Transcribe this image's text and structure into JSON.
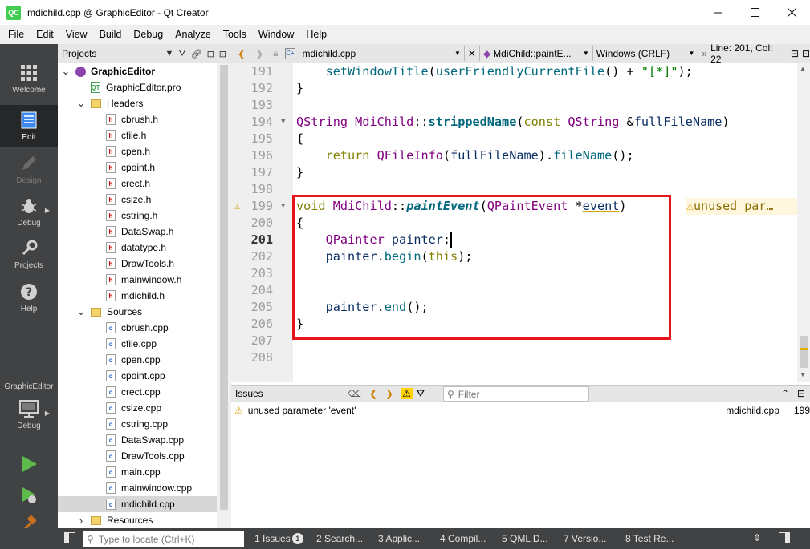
{
  "window": {
    "title": "mdichild.cpp @ GraphicEditor - Qt Creator",
    "app_icon": "QC",
    "controls": [
      "minimize-icon",
      "maximize-icon",
      "close-icon"
    ]
  },
  "menu": [
    "File",
    "Edit",
    "View",
    "Build",
    "Debug",
    "Analyze",
    "Tools",
    "Window",
    "Help"
  ],
  "modes": [
    {
      "label": "Welcome",
      "icon": "grid-icon",
      "state": "normal"
    },
    {
      "label": "Edit",
      "icon": "document-icon",
      "state": "active"
    },
    {
      "label": "Design",
      "icon": "pencil-icon",
      "state": "disabled"
    },
    {
      "label": "Debug",
      "icon": "bug-icon",
      "state": "normal"
    },
    {
      "label": "Projects",
      "icon": "wrench-icon",
      "state": "normal"
    },
    {
      "label": "Help",
      "icon": "help-icon",
      "state": "normal"
    }
  ],
  "kit": {
    "name": "GraphicEditor",
    "mode": "Debug"
  },
  "projects_pane": {
    "title": "Projects",
    "tree": [
      {
        "label": "GraphicEditor",
        "kind": "project",
        "depth": 0,
        "expanded": true,
        "bold": true
      },
      {
        "label": "GraphicEditor.pro",
        "kind": "pro",
        "depth": 1
      },
      {
        "label": "Headers",
        "kind": "folder",
        "depth": 1,
        "expanded": true
      },
      {
        "label": "cbrush.h",
        "kind": "h",
        "depth": 2
      },
      {
        "label": "cfile.h",
        "kind": "h",
        "depth": 2
      },
      {
        "label": "cpen.h",
        "kind": "h",
        "depth": 2
      },
      {
        "label": "cpoint.h",
        "kind": "h",
        "depth": 2
      },
      {
        "label": "crect.h",
        "kind": "h",
        "depth": 2
      },
      {
        "label": "csize.h",
        "kind": "h",
        "depth": 2
      },
      {
        "label": "cstring.h",
        "kind": "h",
        "depth": 2
      },
      {
        "label": "DataSwap.h",
        "kind": "h",
        "depth": 2
      },
      {
        "label": "datatype.h",
        "kind": "h",
        "depth": 2
      },
      {
        "label": "DrawTools.h",
        "kind": "h",
        "depth": 2
      },
      {
        "label": "mainwindow.h",
        "kind": "h",
        "depth": 2
      },
      {
        "label": "mdichild.h",
        "kind": "h",
        "depth": 2
      },
      {
        "label": "Sources",
        "kind": "folder",
        "depth": 1,
        "expanded": true
      },
      {
        "label": "cbrush.cpp",
        "kind": "cpp",
        "depth": 2
      },
      {
        "label": "cfile.cpp",
        "kind": "cpp",
        "depth": 2
      },
      {
        "label": "cpen.cpp",
        "kind": "cpp",
        "depth": 2
      },
      {
        "label": "cpoint.cpp",
        "kind": "cpp",
        "depth": 2
      },
      {
        "label": "crect.cpp",
        "kind": "cpp",
        "depth": 2
      },
      {
        "label": "csize.cpp",
        "kind": "cpp",
        "depth": 2
      },
      {
        "label": "cstring.cpp",
        "kind": "cpp",
        "depth": 2
      },
      {
        "label": "DataSwap.cpp",
        "kind": "cpp",
        "depth": 2
      },
      {
        "label": "DrawTools.cpp",
        "kind": "cpp",
        "depth": 2
      },
      {
        "label": "main.cpp",
        "kind": "cpp",
        "depth": 2
      },
      {
        "label": "mainwindow.cpp",
        "kind": "cpp",
        "depth": 2
      },
      {
        "label": "mdichild.cpp",
        "kind": "cpp",
        "depth": 2,
        "selected": true
      },
      {
        "label": "Resources",
        "kind": "folder",
        "depth": 1,
        "expanded": false
      }
    ]
  },
  "editor_toolbar": {
    "file": "mdichild.cpp",
    "symbol": "MdiChild::paintE...",
    "line_endings": "Windows (CRLF)",
    "position": "Line: 201, Col: 22"
  },
  "editor": {
    "current_line": 201,
    "lines": [
      {
        "n": "191",
        "fold": false,
        "tokens": [
          [
            "pl",
            "    "
          ],
          [
            "fn",
            "setWindowTitle"
          ],
          [
            "pl",
            "("
          ],
          [
            "fn",
            "userFriendlyCurrentFile"
          ],
          [
            "pl",
            "() + "
          ],
          [
            "str",
            "\"[*]\""
          ],
          [
            "pl",
            ");"
          ]
        ]
      },
      {
        "n": "192",
        "fold": false,
        "tokens": [
          [
            "pl",
            "}"
          ]
        ]
      },
      {
        "n": "193",
        "fold": false,
        "tokens": []
      },
      {
        "n": "194",
        "fold": true,
        "tokens": [
          [
            "ty",
            "QString"
          ],
          [
            "pl",
            " "
          ],
          [
            "ty",
            "MdiChild"
          ],
          [
            "pl",
            "::"
          ],
          [
            "fnb",
            "strippedName"
          ],
          [
            "pl",
            "("
          ],
          [
            "kw",
            "const"
          ],
          [
            "pl",
            " "
          ],
          [
            "ty",
            "QString"
          ],
          [
            "pl",
            " &"
          ],
          [
            "var",
            "fullFileName"
          ],
          [
            "pl",
            ")"
          ]
        ]
      },
      {
        "n": "195",
        "fold": false,
        "tokens": [
          [
            "pl",
            "{"
          ]
        ]
      },
      {
        "n": "196",
        "fold": false,
        "tokens": [
          [
            "pl",
            "    "
          ],
          [
            "kw",
            "return"
          ],
          [
            "pl",
            " "
          ],
          [
            "ty",
            "QFileInfo"
          ],
          [
            "pl",
            "("
          ],
          [
            "var",
            "fullFileName"
          ],
          [
            "pl",
            ")."
          ],
          [
            "fn",
            "fileName"
          ],
          [
            "pl",
            "();"
          ]
        ]
      },
      {
        "n": "197",
        "fold": false,
        "tokens": [
          [
            "pl",
            "}"
          ]
        ]
      },
      {
        "n": "198",
        "fold": false,
        "tokens": []
      },
      {
        "n": "199",
        "fold": true,
        "warn": true,
        "tokens": [
          [
            "kw",
            "void"
          ],
          [
            "pl",
            " "
          ],
          [
            "ty",
            "MdiChild"
          ],
          [
            "pl",
            "::"
          ],
          [
            "fni",
            "paintEvent"
          ],
          [
            "pl",
            "("
          ],
          [
            "ty",
            "QPaintEvent"
          ],
          [
            "pl",
            " *"
          ],
          [
            "var ul",
            "event"
          ],
          [
            "pl",
            ")"
          ]
        ]
      },
      {
        "n": "200",
        "fold": false,
        "tokens": [
          [
            "pl",
            "{"
          ]
        ]
      },
      {
        "n": "201",
        "fold": false,
        "tokens": [
          [
            "pl",
            "    "
          ],
          [
            "ty",
            "QPainter"
          ],
          [
            "pl",
            " "
          ],
          [
            "var",
            "painter"
          ],
          [
            "pl",
            ";"
          ]
        ]
      },
      {
        "n": "202",
        "fold": false,
        "tokens": [
          [
            "pl",
            "    "
          ],
          [
            "var",
            "painter"
          ],
          [
            "pl",
            "."
          ],
          [
            "fn",
            "begin"
          ],
          [
            "pl",
            "("
          ],
          [
            "kw",
            "this"
          ],
          [
            "pl",
            ");"
          ]
        ]
      },
      {
        "n": "203",
        "fold": false,
        "tokens": []
      },
      {
        "n": "204",
        "fold": false,
        "tokens": []
      },
      {
        "n": "205",
        "fold": false,
        "tokens": [
          [
            "pl",
            "    "
          ],
          [
            "var",
            "painter"
          ],
          [
            "pl",
            "."
          ],
          [
            "fn",
            "end"
          ],
          [
            "pl",
            "();"
          ]
        ]
      },
      {
        "n": "206",
        "fold": false,
        "tokens": [
          [
            "pl",
            "}"
          ]
        ]
      },
      {
        "n": "207",
        "fold": false,
        "tokens": []
      },
      {
        "n": "208",
        "fold": false,
        "tokens": []
      }
    ],
    "inline_warning": "unused par…"
  },
  "issues": {
    "title": "Issues",
    "filter_placeholder": "Filter",
    "rows": [
      {
        "text": "unused parameter 'event'",
        "file": "mdichild.cpp",
        "line": "199"
      }
    ]
  },
  "statusbar": {
    "locate_placeholder": "Type to locate (Ctrl+K)",
    "tabs": [
      {
        "label": "1  Issues",
        "badge": "1"
      },
      {
        "label": "2  Search..."
      },
      {
        "label": "3  Applic..."
      },
      {
        "label": "4  Compil..."
      },
      {
        "label": "5  QML D..."
      },
      {
        "label": "7  Versio..."
      },
      {
        "label": "8  Test Re..."
      }
    ]
  },
  "colors": {
    "highlight_box": "#e8141d",
    "warning": "#d4a300",
    "modebar": "#404244"
  }
}
